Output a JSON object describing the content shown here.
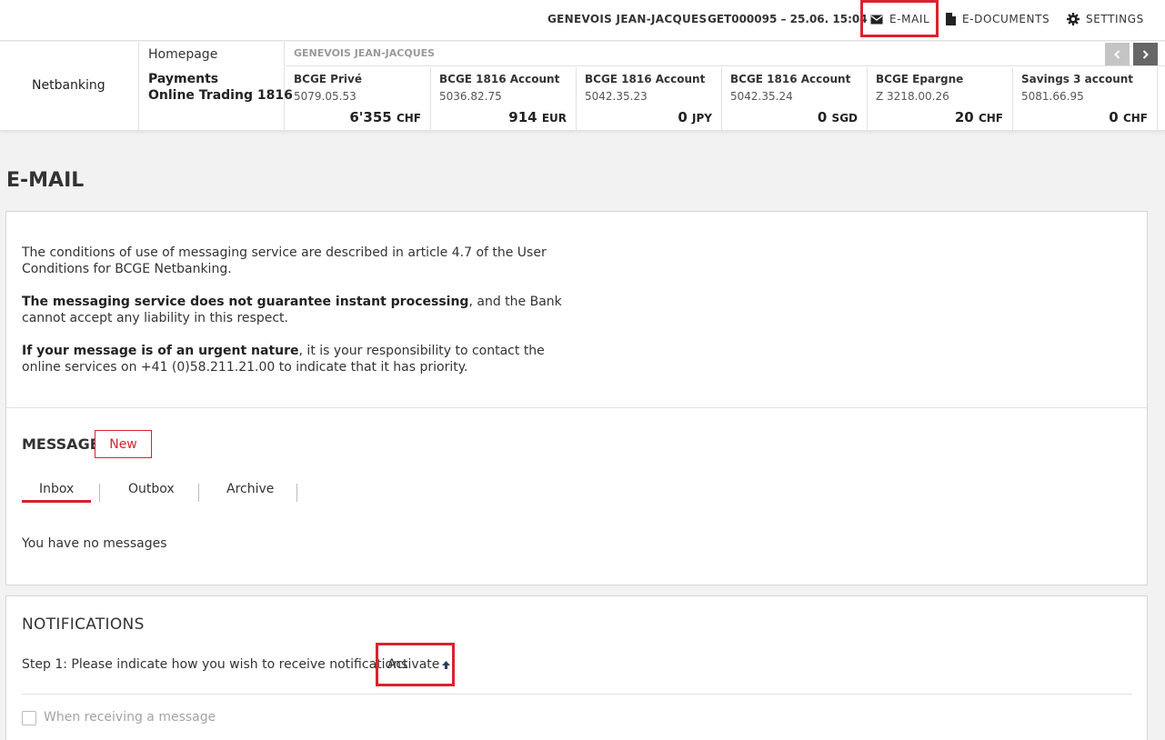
{
  "topbar": {
    "user_name": "GENEVOIS JEAN-JACQUES",
    "session_info": "GET000095  – 25.06. 15:04",
    "email_label": "E-MAIL",
    "edocuments_label": "E-DOCUMENTS",
    "settings_label": "SETTINGS"
  },
  "brand": {
    "name": "Netbanking"
  },
  "menu": {
    "homepage": "Homepage",
    "payments": "Payments",
    "trading": "Online Trading 1816"
  },
  "accounts": {
    "holder": "GENEVOIS JEAN-JACQUES",
    "items": [
      {
        "name": "BCGE Privé",
        "number": "5079.05.53",
        "balance": "6'355",
        "currency": "CHF"
      },
      {
        "name": "BCGE 1816 Account",
        "number": "5036.82.75",
        "balance": "914",
        "currency": "EUR"
      },
      {
        "name": "BCGE 1816 Account",
        "number": "5042.35.23",
        "balance": "0",
        "currency": "JPY"
      },
      {
        "name": "BCGE 1816 Account",
        "number": "5042.35.24",
        "balance": "0",
        "currency": "SGD"
      },
      {
        "name": "BCGE Epargne",
        "number": "Z 3218.00.26",
        "balance": "20",
        "currency": "CHF"
      },
      {
        "name": "Savings 3 account",
        "number": "5081.66.95",
        "balance": "0",
        "currency": "CHF"
      }
    ]
  },
  "page": {
    "title": "E-MAIL"
  },
  "info": {
    "p1": "The conditions of use of messaging service are described in article 4.7 of the User Conditions for BCGE Netbanking.",
    "p2_bold": "The messaging service does not guarantee instant processing",
    "p2_rest": ", and the Bank cannot accept any liability in this respect.",
    "p3_bold": "If your message is of an urgent nature",
    "p3_rest": ", it is your responsibility to contact the online services on +41 (0)58.211.21.00 to indicate that it has priority."
  },
  "message": {
    "title": "MESSAGE",
    "new_button": "New",
    "tabs": [
      "Inbox",
      "Outbox",
      "Archive"
    ],
    "active_tab": "Inbox",
    "empty_text": "You have no messages"
  },
  "notifications": {
    "title": "NOTIFICATIONS",
    "step1": "Step 1: Please indicate how you wish to receive notifications",
    "activate_label": "Activate",
    "option_label": "When receiving a message"
  },
  "colors": {
    "accent": "#d9232e",
    "text": "#333333",
    "muted": "#a3a3a3"
  }
}
